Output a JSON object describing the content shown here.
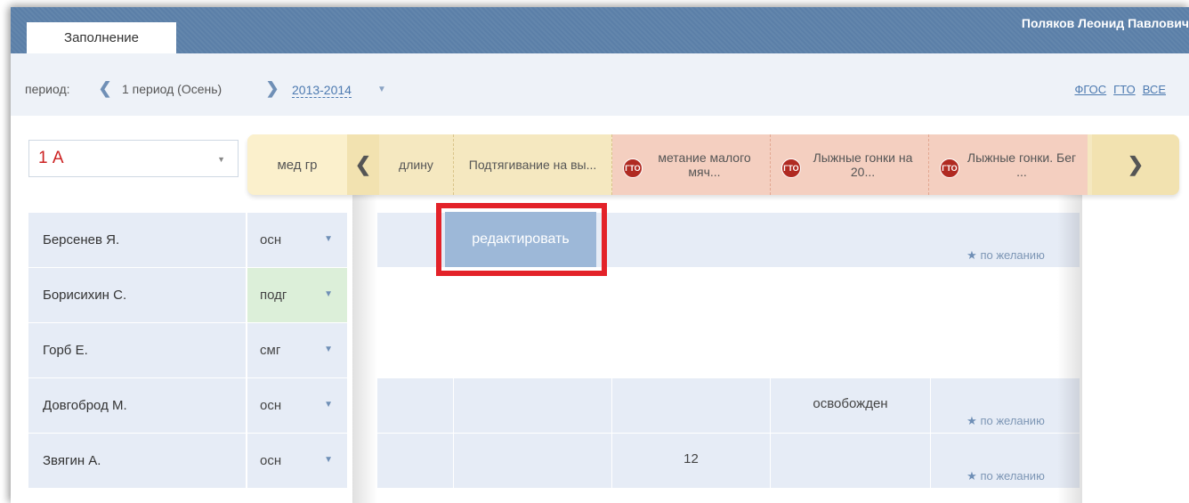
{
  "topbar": {
    "active_tab": "Заполнение",
    "user_name": "Поляков Леонид Павлович"
  },
  "period": {
    "label": "период:",
    "name": "1 период (Осень)",
    "year": "2013-2014",
    "filters": [
      "ФГОС",
      "ГТО",
      "ВСЕ"
    ]
  },
  "class_select": {
    "value": "1 А"
  },
  "headers": {
    "group_label": "мед гр",
    "columns": [
      {
        "label": "длину",
        "gto": false
      },
      {
        "label": "Подтягивание на вы...",
        "gto": false
      },
      {
        "label": "метание малого мяч...",
        "gto": true
      },
      {
        "label": "Лыжные гонки на 20...",
        "gto": true
      },
      {
        "label": "Лыжные гонки. Бег ...",
        "gto": true
      }
    ],
    "gto_badge": "ГТО"
  },
  "students": [
    {
      "name": "Берсенев Я.",
      "group": "осн"
    },
    {
      "name": "Борисихин С.",
      "group": "подг"
    },
    {
      "name": "Горб Е.",
      "group": "смг"
    },
    {
      "name": "Довгоброд М.",
      "group": "осн"
    },
    {
      "name": "Звягин А.",
      "group": "осн"
    }
  ],
  "cells": {
    "edit_button": "редактировать",
    "exempt": "освобожден",
    "value_zvyagin": "12",
    "wish": "по желанию"
  },
  "colors": {
    "topbar": "#5b7fa8",
    "highlight": "#e32229",
    "gto_badge": "#b02a22"
  }
}
